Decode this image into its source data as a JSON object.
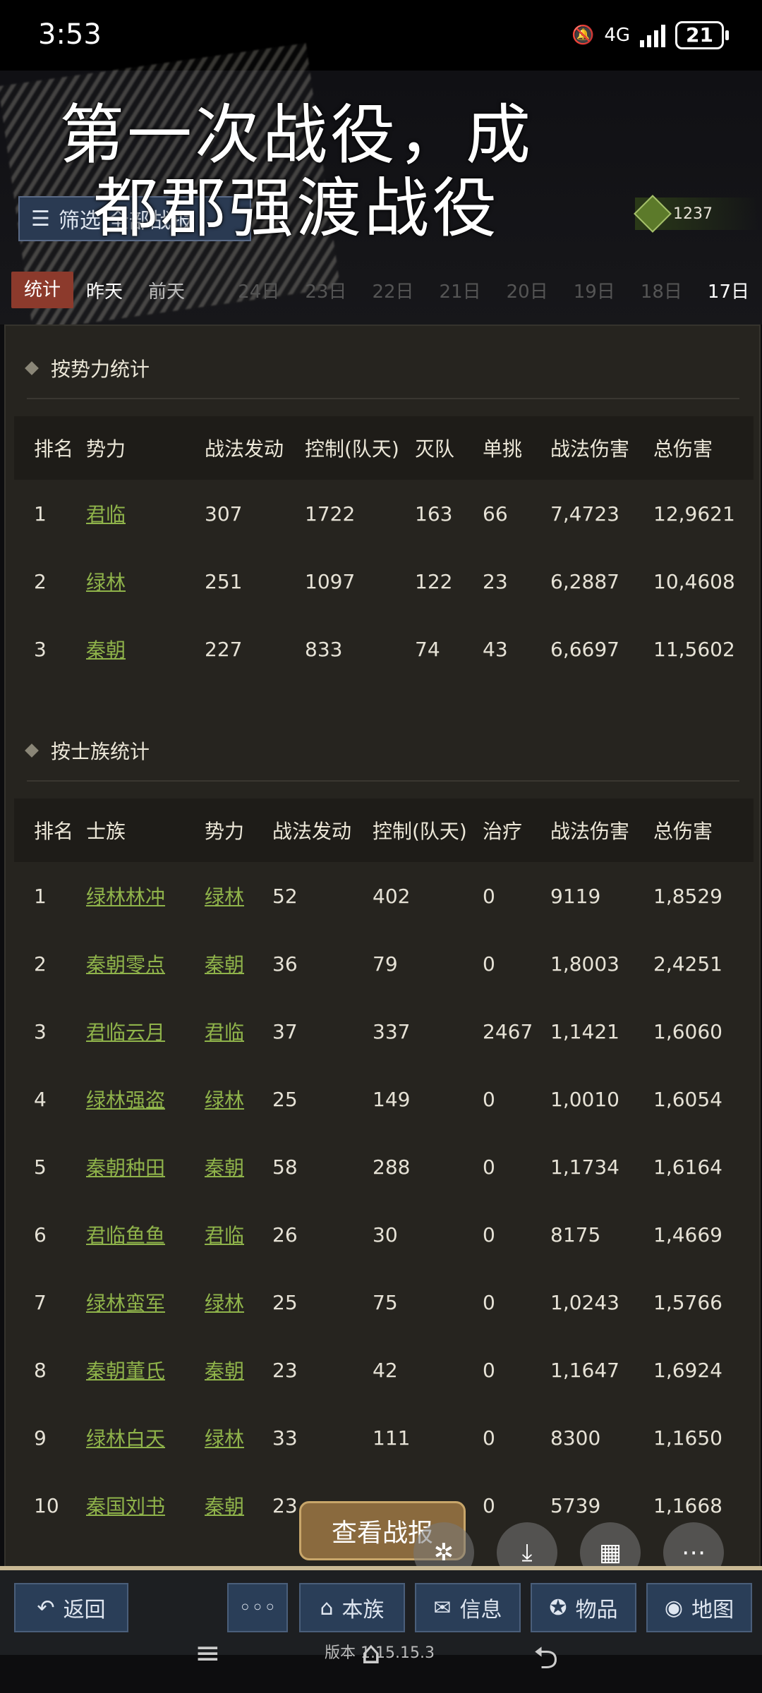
{
  "status": {
    "time": "3:53",
    "network": "4G",
    "battery": "21"
  },
  "overlay_title": "第一次战役，成都郡强渡战役",
  "filter_button": "筛选 全部战报",
  "resource": "1237",
  "tabs": [
    "统计",
    "昨天",
    "前天",
    "",
    "24日",
    "23日",
    "22日",
    "21日",
    "20日",
    "19日",
    "18日",
    "17日"
  ],
  "faction_section": {
    "title": "按势力统计",
    "headers": [
      "排名",
      "势力",
      "战法发动",
      "控制(队天)",
      "灭队",
      "单挑",
      "战法伤害",
      "总伤害"
    ],
    "rows": [
      [
        "1",
        "君临",
        "307",
        "1722",
        "163",
        "66",
        "7,4723",
        "12,9621"
      ],
      [
        "2",
        "绿林",
        "251",
        "1097",
        "122",
        "23",
        "6,2887",
        "10,4608"
      ],
      [
        "3",
        "秦朝",
        "227",
        "833",
        "74",
        "43",
        "6,6697",
        "11,5602"
      ]
    ]
  },
  "clan_section": {
    "title": "按士族统计",
    "headers": [
      "排名",
      "士族",
      "势力",
      "战法发动",
      "控制(队天)",
      "治疗",
      "战法伤害",
      "总伤害"
    ],
    "rows": [
      [
        "1",
        "绿林林冲",
        "绿林",
        "52",
        "402",
        "0",
        "9119",
        "1,8529"
      ],
      [
        "2",
        "秦朝零点",
        "秦朝",
        "36",
        "79",
        "0",
        "1,8003",
        "2,4251"
      ],
      [
        "3",
        "君临云月",
        "君临",
        "37",
        "337",
        "2467",
        "1,1421",
        "1,6060"
      ],
      [
        "4",
        "绿林强盗",
        "绿林",
        "25",
        "149",
        "0",
        "1,0010",
        "1,6054"
      ],
      [
        "5",
        "秦朝种田",
        "秦朝",
        "58",
        "288",
        "0",
        "1,1734",
        "1,6164"
      ],
      [
        "6",
        "君临鱼鱼",
        "君临",
        "26",
        "30",
        "0",
        "8175",
        "1,4669"
      ],
      [
        "7",
        "绿林蛮军",
        "绿林",
        "25",
        "75",
        "0",
        "1,0243",
        "1,5766"
      ],
      [
        "8",
        "秦朝董氏",
        "秦朝",
        "23",
        "42",
        "0",
        "1,1647",
        "1,6924"
      ],
      [
        "9",
        "绿林白天",
        "绿林",
        "33",
        "111",
        "0",
        "8300",
        "1,1650"
      ],
      [
        "10",
        "秦国刘书",
        "秦朝",
        "23",
        "",
        "0",
        "5739",
        "1,1668"
      ]
    ]
  },
  "report_button": "查看战报",
  "bottom": {
    "back": "返回",
    "more": "◦◦◦",
    "clan": "本族",
    "info": "信息",
    "items": "物品",
    "map": "地图"
  },
  "version": "版本 1.15.15.3",
  "colors": {
    "accent": "#8c3a2c",
    "link": "#8fb34a",
    "panel": "#26241f"
  }
}
